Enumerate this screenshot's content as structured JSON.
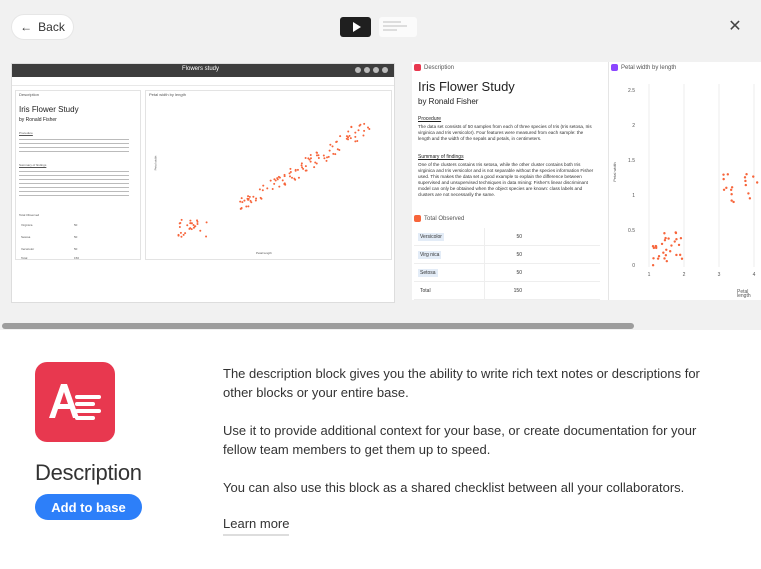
{
  "header": {
    "back_label": "Back",
    "back_icon": "arrow-left-icon",
    "play_icon": "play-icon",
    "close_icon": "close-icon"
  },
  "gallery": {
    "screenshot1": {
      "base_title": "Flowers study",
      "desc_block_label": "Description",
      "chart_block_label": "Petal width by length",
      "total_block_label": "Total Observed",
      "doc_title": "Iris Flower Study",
      "doc_author": "by Ronald Fisher",
      "procedure_label": "Procedure",
      "summary_label": "Summary of findings",
      "rows": [
        {
          "name": "Virginica",
          "value": "50"
        },
        {
          "name": "Setosa",
          "value": "50"
        },
        {
          "name": "Versicolor",
          "value": "50"
        },
        {
          "name": "Total",
          "value": "150"
        }
      ],
      "x_axis_label": "Petal length",
      "y_axis_label": "Petal width"
    },
    "screenshot2": {
      "desc_block_label": "Description",
      "doc_title": "Iris Flower Study",
      "doc_author": "by Ronald Fisher",
      "procedure_label": "Procedure",
      "procedure_text": "The data set consists of 50 samples from each of three species of Iris (Iris setosa, Iris virginica and Iris versicolor). Four features were measured from each sample: the length and the width of the sepals and petals, in centimeters.",
      "summary_label": "Summary of findings",
      "summary_text": "One of the clusters contains Iris setosa, while the other cluster contains both Iris virginica and Iris versicolor and is not separable without the species information Fisher used. This makes the data set a good example to explain the difference between supervised and unsupervised techniques in data mining: Fisher's linear discriminant model can only be obtained when the object species are known: class labels and clusters are not necessarily the same.",
      "total_block_label": "Total Observed",
      "rows": [
        {
          "name": "Versicolor",
          "value": "50"
        },
        {
          "name": "Virg nica",
          "value": "50"
        },
        {
          "name": "Setosa",
          "value": "50"
        },
        {
          "name": "Total",
          "value": "150"
        }
      ],
      "chart_block_label": "Petal width by length",
      "y_ticks": [
        "2.5",
        "2",
        "1.5",
        "1",
        "0.5",
        "0"
      ],
      "x_ticks": [
        "1",
        "2",
        "3",
        "4"
      ],
      "x_axis_label": "Petal length",
      "y_axis_label": "Petal width"
    }
  },
  "app": {
    "name": "Description",
    "icon": "description-text-icon",
    "icon_color": "#e8384f",
    "add_label": "Add to base",
    "accent": "#2d7ff9",
    "paragraphs": [
      "The description block gives you the ability to write rich text notes or descriptions for other blocks or your entire base.",
      "Use it to provide additional context for your base, or create documentation for your fellow team members to get them up to speed.",
      "You can also use this block as a shared checklist between all your collaborators."
    ],
    "learn_more": "Learn more"
  }
}
